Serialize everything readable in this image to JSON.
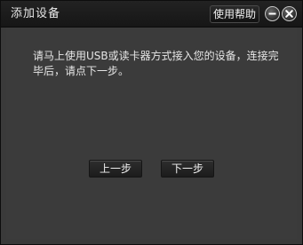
{
  "window": {
    "title": "添加设备",
    "help_label": "使用帮助",
    "minimize_icon": "minimize-icon",
    "close_icon": "close-icon"
  },
  "main": {
    "message": "请马上使用USB或读卡器方式接入您的设备，连接完毕后，请点下一步。",
    "prev_label": "上一步",
    "next_label": "下一步"
  },
  "colors": {
    "background": "#3a3a3a",
    "titlebar": "#1a1a1a",
    "text": "#e6e6e6"
  }
}
